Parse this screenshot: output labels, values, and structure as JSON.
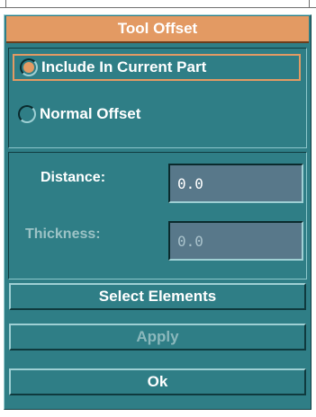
{
  "dialog": {
    "title": "Tool Offset",
    "options": [
      {
        "label": "Include In Current Part",
        "selected": true
      },
      {
        "label": "Normal Offset",
        "selected": false
      }
    ],
    "fields": {
      "distance": {
        "label": "Distance:",
        "value": "0.0",
        "enabled": true
      },
      "thickness": {
        "label": "Thickness:",
        "value": "0.0",
        "enabled": false
      }
    },
    "buttons": {
      "select_elements": "Select Elements",
      "apply": "Apply",
      "ok": "Ok"
    }
  },
  "colors": {
    "panel": "#2f7e86",
    "title_bar": "#e39a63",
    "field": "#58788a"
  }
}
